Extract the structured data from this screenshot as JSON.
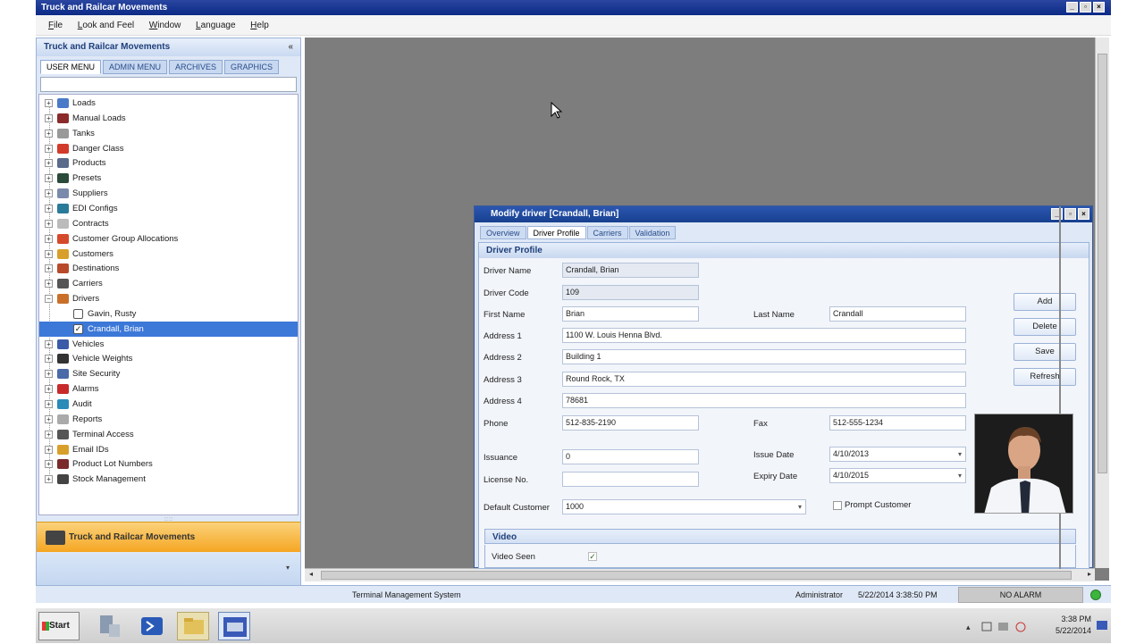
{
  "window": {
    "title": "Truck and Railcar Movements",
    "controls": [
      "_",
      "▫",
      "×"
    ]
  },
  "menu": [
    "File",
    "Look and Feel",
    "Window",
    "Language",
    "Help"
  ],
  "left_panel": {
    "title": "Truck and Railcar Movements",
    "collapse_glyph": "«",
    "tabs": [
      "USER MENU",
      "ADMIN MENU",
      "ARCHIVES",
      "GRAPHICS"
    ],
    "tree": [
      {
        "label": "Loads",
        "icon": "loads-icon",
        "color": "#4a7bc8"
      },
      {
        "label": "Manual Loads",
        "icon": "manual-loads-icon",
        "color": "#8a2a2a"
      },
      {
        "label": "Tanks",
        "icon": "tanks-icon",
        "color": "#999999"
      },
      {
        "label": "Danger Class",
        "icon": "danger-class-icon",
        "color": "#d23a2a"
      },
      {
        "label": "Products",
        "icon": "products-icon",
        "color": "#5a6a8a"
      },
      {
        "label": "Presets",
        "icon": "presets-icon",
        "color": "#2a4a3a"
      },
      {
        "label": "Suppliers",
        "icon": "suppliers-icon",
        "color": "#7a8aaa"
      },
      {
        "label": "EDI Configs",
        "icon": "edi-configs-icon",
        "color": "#2a7a9a"
      },
      {
        "label": "Contracts",
        "icon": "contracts-icon",
        "color": "#bbbbbb"
      },
      {
        "label": "Customer Group Allocations",
        "icon": "customer-group-icon",
        "color": "#d44a2a"
      },
      {
        "label": "Customers",
        "icon": "customers-icon",
        "color": "#d8a02a"
      },
      {
        "label": "Destinations",
        "icon": "destinations-icon",
        "color": "#b84a2a"
      },
      {
        "label": "Carriers",
        "icon": "carriers-icon",
        "color": "#555555"
      },
      {
        "label": "Drivers",
        "icon": "drivers-icon",
        "color": "#c8702a"
      },
      {
        "label": "Vehicles",
        "icon": "vehicles-icon",
        "color": "#3a5aa8"
      },
      {
        "label": "Vehicle Weights",
        "icon": "vehicle-weights-icon",
        "color": "#333333"
      },
      {
        "label": "Site Security",
        "icon": "site-security-icon",
        "color": "#4a6aa8"
      },
      {
        "label": "Alarms",
        "icon": "alarms-icon",
        "color": "#c82a2a"
      },
      {
        "label": "Audit",
        "icon": "audit-icon",
        "color": "#2a8ab8"
      },
      {
        "label": "Reports",
        "icon": "reports-icon",
        "color": "#aaaaaa"
      },
      {
        "label": "Terminal Access",
        "icon": "terminal-access-icon",
        "color": "#555555"
      },
      {
        "label": "Email IDs",
        "icon": "email-ids-icon",
        "color": "#d8a02a"
      },
      {
        "label": "Product Lot Numbers",
        "icon": "product-lot-icon",
        "color": "#7a2a2a"
      },
      {
        "label": "Stock Management",
        "icon": "stock-management-icon",
        "color": "#444444"
      }
    ],
    "drivers_children": [
      {
        "label": "Gavin, Rusty",
        "checked": false
      },
      {
        "label": "Crandall, Brian",
        "checked": true,
        "selected": true
      }
    ],
    "footer_title": "Truck and Railcar Movements",
    "footer_dropdown": "▾"
  },
  "child_window": {
    "title": "Modify driver [Crandall, Brian]",
    "tabs": [
      "Overview",
      "Driver Profile",
      "Carriers",
      "Validation"
    ],
    "active_tab": "Driver Profile",
    "section_title": "Driver Profile",
    "fields": {
      "driver_name": {
        "label": "Driver Name",
        "value": "Crandall, Brian"
      },
      "driver_code": {
        "label": "Driver Code",
        "value": "109"
      },
      "first_name": {
        "label": "First Name",
        "value": "Brian"
      },
      "last_name": {
        "label": "Last Name",
        "value": "Crandall"
      },
      "address1": {
        "label": "Address 1",
        "value": "1100 W. Louis Henna Blvd."
      },
      "address2": {
        "label": "Address 2",
        "value": "Building 1"
      },
      "address3": {
        "label": "Address 3",
        "value": "Round Rock, TX"
      },
      "address4": {
        "label": "Address 4",
        "value": "78681"
      },
      "phone": {
        "label": "Phone",
        "value": "512-835-2190"
      },
      "fax": {
        "label": "Fax",
        "value": "512-555-1234"
      },
      "issuance": {
        "label": "Issuance",
        "value": "0"
      },
      "issue_date": {
        "label": "Issue Date",
        "value": "4/10/2013"
      },
      "license_no": {
        "label": "License No.",
        "value": ""
      },
      "expiry_date": {
        "label": "Expiry Date",
        "value": "4/10/2015"
      },
      "default_customer": {
        "label": "Default Customer",
        "value": "1000"
      },
      "prompt_customer": {
        "label": "Prompt Customer",
        "checked": false
      }
    },
    "buttons": {
      "add": "Add",
      "delete": "Delete",
      "save": "Save",
      "refresh": "Refresh"
    },
    "video": {
      "title": "Video",
      "video_seen_label": "Video Seen",
      "video_seen": true
    }
  },
  "status_bar": {
    "app": "Terminal Management System",
    "user": "Administrator",
    "datetime": "5/22/2014 3:38:50 PM",
    "alarm": "NO ALARM",
    "alarm_color": "#3bb53b"
  },
  "taskbar": {
    "start_label": "Start",
    "time": "3:38 PM",
    "date": "5/22/2014"
  }
}
